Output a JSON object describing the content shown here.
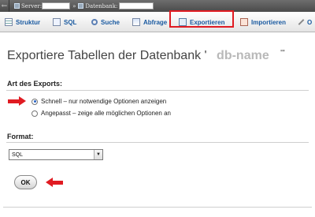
{
  "breadcrumb": {
    "server_label": "Server:",
    "database_label": "Datenbank:"
  },
  "tabs": [
    {
      "label": "Struktur",
      "icon": "structure-icon"
    },
    {
      "label": "SQL",
      "icon": "sql-icon"
    },
    {
      "label": "Suche",
      "icon": "search-icon"
    },
    {
      "label": "Abfrage",
      "icon": "query-icon"
    },
    {
      "label": "Exportieren",
      "icon": "export-icon",
      "active": true
    },
    {
      "label": "Importieren",
      "icon": "import-icon"
    },
    {
      "label": "O",
      "icon": "operations-icon"
    }
  ],
  "page": {
    "title": "Exportiere Tabellen der Datenbank '",
    "db_name": "db-name",
    "title_end": "'\""
  },
  "export_type": {
    "label": "Art des Exports:",
    "options": [
      {
        "label": "Schnell – nur notwendige Optionen anzeigen",
        "checked": true
      },
      {
        "label": "Angepasst – zeige alle möglichen Optionen an",
        "checked": false
      }
    ]
  },
  "format": {
    "label": "Format:",
    "selected": "SQL"
  },
  "submit": {
    "label": "OK"
  },
  "colors": {
    "highlight": "#e01b22",
    "tab_text": "#1a5aa0",
    "db_name": "#b9b9b9"
  }
}
